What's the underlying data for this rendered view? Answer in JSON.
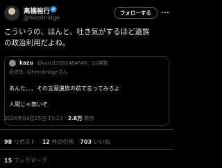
{
  "author": {
    "name": "高橋裕行",
    "handle": "@herobridge",
    "verified_color": "#1d9bf0"
  },
  "follow_button_label": "フォローする",
  "tweet": {
    "text_line1": "こういうの、ほんと、吐き気がするほど遺族",
    "text_line2": "の政治利用だよね。"
  },
  "quote": {
    "name": "kazu",
    "meta": "@kazu12581484548 · 11時間",
    "reply_prefix": "返信先: ",
    "reply_handle": "@herobridgeさん",
    "line1": "あんた、、、その言葉遺族の前で言ってみろよ",
    "line2": "人間じゃ無いぞ"
  },
  "post_meta": {
    "timestamp": "2026年04月15日 15:13 · ",
    "views_count": "2.8万",
    "views_label": " 表示"
  },
  "stats": {
    "reposts_count": "98",
    "reposts_label": "リポスト",
    "quotes_count": "12",
    "quotes_label": "件の引用",
    "likes_count": "703",
    "likes_label": "いいね",
    "bookmarks_count": "15",
    "bookmarks_label": "ブックマーク"
  },
  "icons": {
    "verified": "verified-badge-icon",
    "more": "more-options-icon"
  }
}
